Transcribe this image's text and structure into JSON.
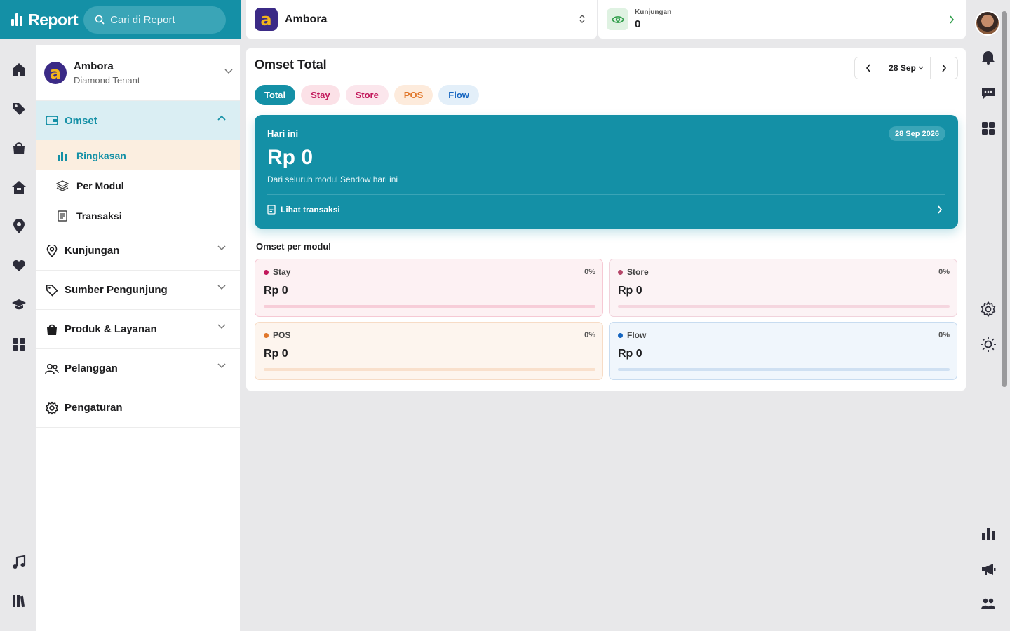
{
  "brand": {
    "title": "Report",
    "search_placeholder": "Cari di Report"
  },
  "tenant": {
    "logo_letter": "a",
    "name": "Ambora",
    "subtitle": "Diamond Tenant"
  },
  "menu": {
    "omset": {
      "label": "Omset"
    },
    "omset_sub": [
      {
        "label": "Ringkasan",
        "icon": "bar-chart-icon"
      },
      {
        "label": "Per Modul",
        "icon": "layers-icon"
      },
      {
        "label": "Transaksi",
        "icon": "receipt-icon"
      }
    ],
    "items": [
      {
        "label": "Kunjungan",
        "icon": "location-pin-icon"
      },
      {
        "label": "Sumber Pengunjung",
        "icon": "tag-icon"
      },
      {
        "label": "Produk & Layanan",
        "icon": "shopping-bag-icon"
      },
      {
        "label": "Pelanggan",
        "icon": "users-icon"
      },
      {
        "label": "Pengaturan",
        "icon": "gear-icon"
      }
    ]
  },
  "topbar": {
    "tenant_name": "Ambora",
    "visit_label": "Kunjungan",
    "visit_value": "0"
  },
  "main": {
    "title": "Omset Total",
    "date_label": "28 Sep",
    "tabs": [
      {
        "label": "Total",
        "bg": "#1490a6",
        "fg": "#ffffff"
      },
      {
        "label": "Stay",
        "bg": "#fbe1e7",
        "fg": "#c2185b"
      },
      {
        "label": "Store",
        "bg": "#fbe6ec",
        "fg": "#c2185b"
      },
      {
        "label": "POS",
        "bg": "#fdebdc",
        "fg": "#e0762a"
      },
      {
        "label": "Flow",
        "bg": "#e3eff9",
        "fg": "#1565c0"
      }
    ],
    "hero": {
      "label": "Hari ini",
      "date": "28 Sep 2026",
      "amount": "Rp 0",
      "description": "Dari seluruh modul Sendow hari ini",
      "link": "Lihat transaksi"
    },
    "modules_title": "Omset per modul",
    "modules": [
      {
        "name": "Stay",
        "value": "Rp 0",
        "pct": "0%",
        "percent": 0,
        "dot": "#c2185b",
        "bg": "#fdf1f3",
        "border": "#f6c9d4",
        "bar": "#f7cdd8"
      },
      {
        "name": "Store",
        "value": "Rp 0",
        "pct": "0%",
        "percent": 0,
        "dot": "#b5476a",
        "bg": "#fcf3f5",
        "border": "#f1d3dc",
        "bar": "#f5d6df"
      },
      {
        "name": "POS",
        "value": "Rp 0",
        "pct": "0%",
        "percent": 0,
        "dot": "#e0762a",
        "bg": "#fdf5ee",
        "border": "#f7dcc6",
        "bar": "#f9e0cc"
      },
      {
        "name": "Flow",
        "value": "Rp 0",
        "pct": "0%",
        "percent": 0,
        "dot": "#1565c0",
        "bg": "#f0f6fc",
        "border": "#c8dcf0",
        "bar": "#cfe0f2"
      }
    ]
  },
  "colors": {
    "accent": "#1490a6",
    "rail_bg": "#e8e8ea"
  }
}
